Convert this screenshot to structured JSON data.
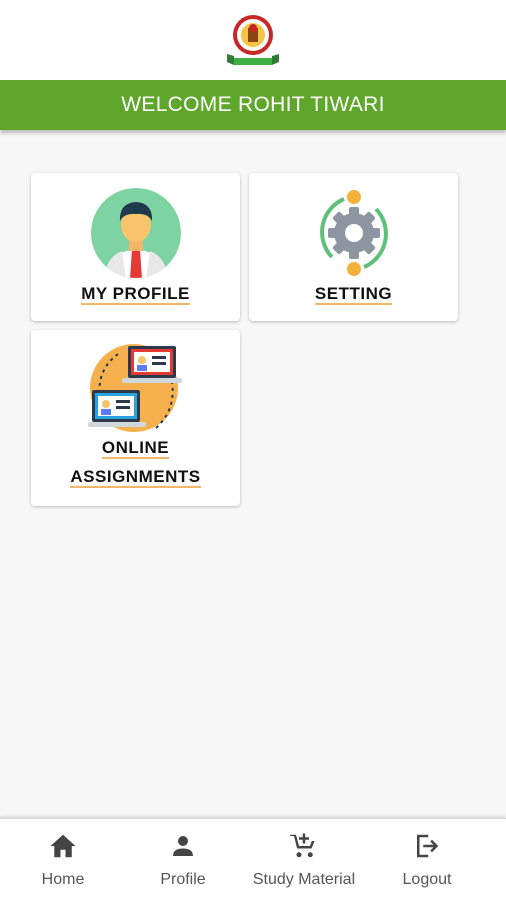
{
  "header": {
    "welcome_text": "WELCOME ROHIT TIWARI",
    "accent_color": "#5ea72b"
  },
  "dashboard": {
    "cards": [
      {
        "label": "MY PROFILE",
        "icon": "profile-avatar-icon"
      },
      {
        "label": "SETTING",
        "icon": "settings-gear-icon"
      },
      {
        "label_line1": "ONLINE",
        "label_line2": "ASSIGNMENTS",
        "icon": "online-assignments-icon"
      }
    ]
  },
  "bottom_nav": {
    "items": [
      {
        "label": "Home",
        "icon": "home-icon"
      },
      {
        "label": "Profile",
        "icon": "person-icon"
      },
      {
        "label": "Study Material",
        "icon": "cart-add-icon"
      },
      {
        "label": "Logout",
        "icon": "logout-icon"
      }
    ]
  }
}
